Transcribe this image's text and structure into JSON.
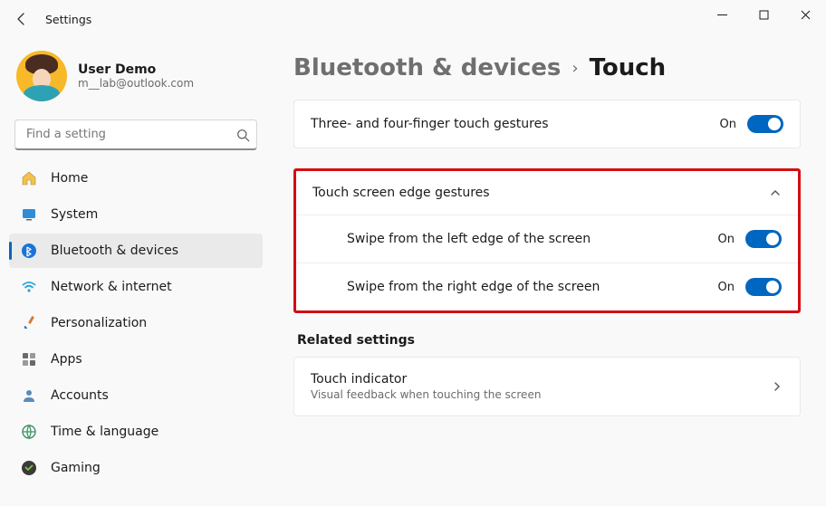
{
  "window": {
    "title": "Settings"
  },
  "profile": {
    "name": "User Demo",
    "email": "m__lab@outlook.com"
  },
  "search": {
    "placeholder": "Find a setting"
  },
  "sidebar": {
    "items": [
      {
        "label": "Home"
      },
      {
        "label": "System"
      },
      {
        "label": "Bluetooth & devices"
      },
      {
        "label": "Network & internet"
      },
      {
        "label": "Personalization"
      },
      {
        "label": "Apps"
      },
      {
        "label": "Accounts"
      },
      {
        "label": "Time & language"
      },
      {
        "label": "Gaming"
      }
    ]
  },
  "breadcrumb": {
    "parent": "Bluetooth & devices",
    "current": "Touch"
  },
  "settings": {
    "gestures": {
      "title": "Three- and four-finger touch gestures",
      "state": "On"
    },
    "edge": {
      "title": "Touch screen edge gestures",
      "left": {
        "label": "Swipe from the left edge of the screen",
        "state": "On"
      },
      "right": {
        "label": "Swipe from the right edge of the screen",
        "state": "On"
      }
    }
  },
  "related": {
    "heading": "Related settings",
    "touch_indicator": {
      "title": "Touch indicator",
      "subtitle": "Visual feedback when touching the screen"
    }
  }
}
